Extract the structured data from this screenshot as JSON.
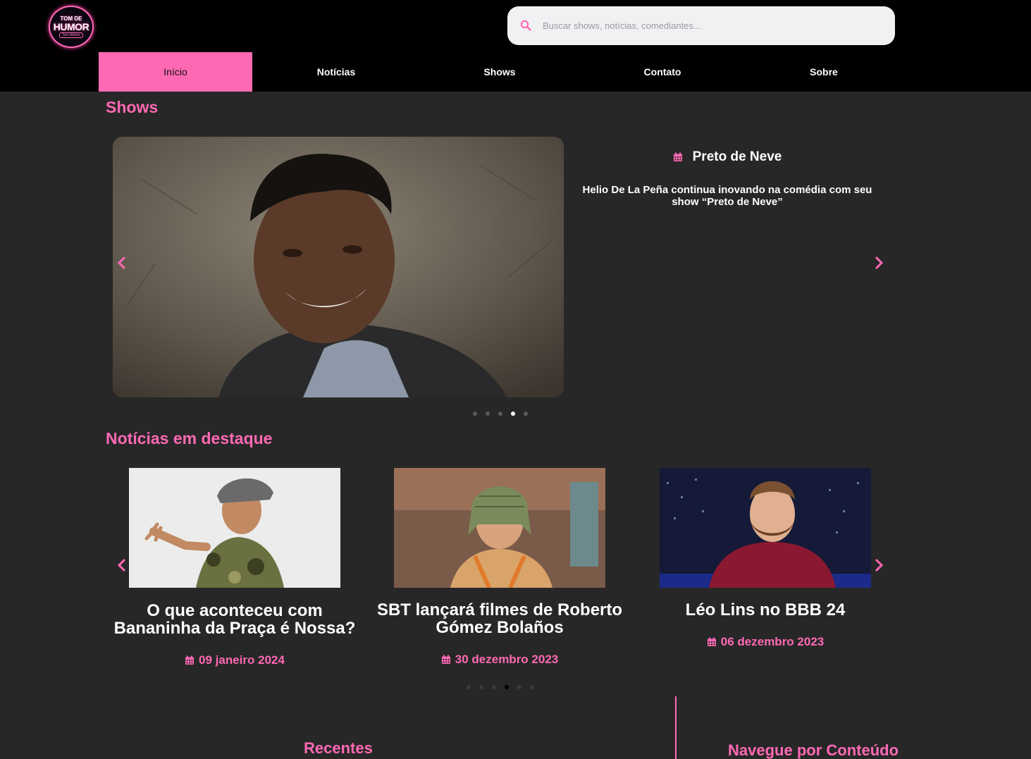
{
  "logo": {
    "line1": "TOM DE",
    "line2": "HUMOR",
    "line3": "Tom Afetivo"
  },
  "search": {
    "placeholder": "Buscar shows, notícias, comediantes..."
  },
  "nav": {
    "items": [
      "Início",
      "Notícias",
      "Shows",
      "Contato",
      "Sobre"
    ],
    "active": "Início"
  },
  "shows": {
    "section_title": "Shows",
    "current": {
      "title": "Preto de Neve",
      "description": "Helio De La Peña continua inovando na comédia com seu show “Preto de Neve”"
    },
    "carousel": {
      "total_slides": 5,
      "active_index": 3
    }
  },
  "news": {
    "section_title": "Notícias em destaque",
    "cards": [
      {
        "title": "O que aconteceu com Bananinha da Praça é Nossa?",
        "date": "09 janeiro 2024"
      },
      {
        "title": "SBT lançará filmes de Roberto Gómez Bolaños",
        "date": "30 dezembro 2023"
      },
      {
        "title": "Léo Lins no BBB 24",
        "date": "06 dezembro 2023"
      }
    ],
    "carousel": {
      "total_slides": 6,
      "active_index": 3
    }
  },
  "footer": {
    "recent_title": "Recentes",
    "browse_title": "Navegue por Conteúdo"
  },
  "colors": {
    "accent": "#ff69b4",
    "background": "#272727",
    "header": "#000000"
  },
  "icons": {
    "search": "search-icon",
    "calendar": "calendar-icon",
    "prev": "chevron-left-icon",
    "next": "chevron-right-icon"
  }
}
